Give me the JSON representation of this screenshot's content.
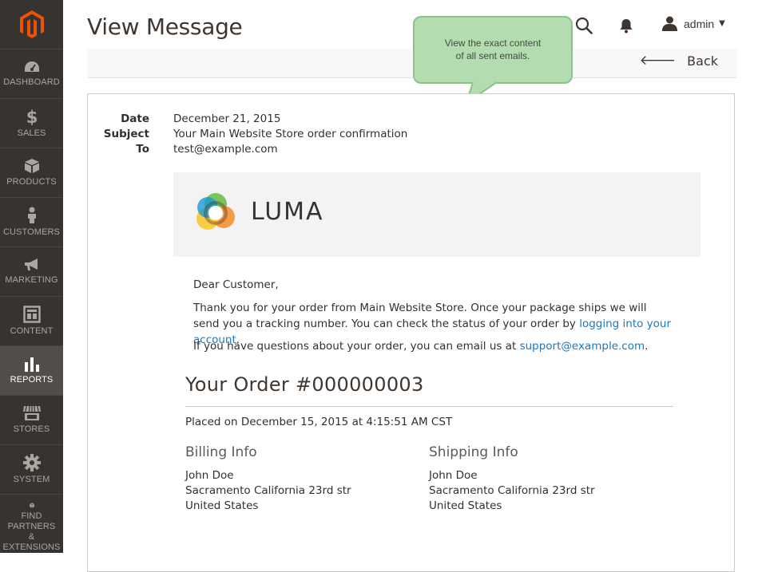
{
  "sidebar": {
    "items": [
      {
        "label": "DASHBOARD",
        "icon": "dashboard-icon"
      },
      {
        "label": "SALES",
        "icon": "dollar-icon"
      },
      {
        "label": "PRODUCTS",
        "icon": "box-icon"
      },
      {
        "label": "CUSTOMERS",
        "icon": "person-icon"
      },
      {
        "label": "MARKETING",
        "icon": "megaphone-icon"
      },
      {
        "label": "CONTENT",
        "icon": "layout-icon"
      },
      {
        "label": "REPORTS",
        "icon": "bar-chart-icon"
      },
      {
        "label": "STORES",
        "icon": "storefront-icon"
      },
      {
        "label": "SYSTEM",
        "icon": "gear-icon"
      },
      {
        "label": "FIND PARTNERS\n& EXTENSIONS",
        "label_1": "FIND PARTNERS",
        "label_2": "& EXTENSIONS",
        "icon": "cubes-icon"
      }
    ],
    "active": "REPORTS"
  },
  "header": {
    "title": "View Message",
    "user": "admin"
  },
  "actions": {
    "back_label": "Back"
  },
  "tooltip": {
    "line1": "View the exact content",
    "line2": "of all sent emails."
  },
  "message": {
    "meta": [
      {
        "label": "Date",
        "value": "December 21, 2015"
      },
      {
        "label": "Subject",
        "value": "Your Main Website Store order confirmation"
      },
      {
        "label": "To",
        "value": "test@example.com"
      }
    ],
    "brand": "LUMA",
    "greeting": "Dear Customer,",
    "para1_a": "Thank you for your order from Main Website Store. Once your package ships we will send you a tracking number. You can check the status of your order by ",
    "para1_link": "logging into your account",
    "para1_b": ".",
    "para2_a": "If you have questions about your order, you can email us at ",
    "para2_link": "support@example.com",
    "para2_b": ".",
    "order_title": "Your Order #000000003",
    "placed": "Placed on December 15, 2015 at 4:15:51 AM CST",
    "billing": {
      "heading": "Billing Info",
      "lines": [
        "John Doe",
        "Sacramento California 23rd str",
        "United States"
      ]
    },
    "shipping": {
      "heading": "Shipping Info",
      "lines": [
        "John Doe",
        "Sacramento California 23rd str",
        "United States"
      ]
    }
  },
  "colors": {
    "sidebar_bg": "#373330",
    "sidebar_active": "#524d49",
    "brand_orange": "#eb5202",
    "link": "#1979c3",
    "tooltip_bg": "#b4dcb1"
  }
}
